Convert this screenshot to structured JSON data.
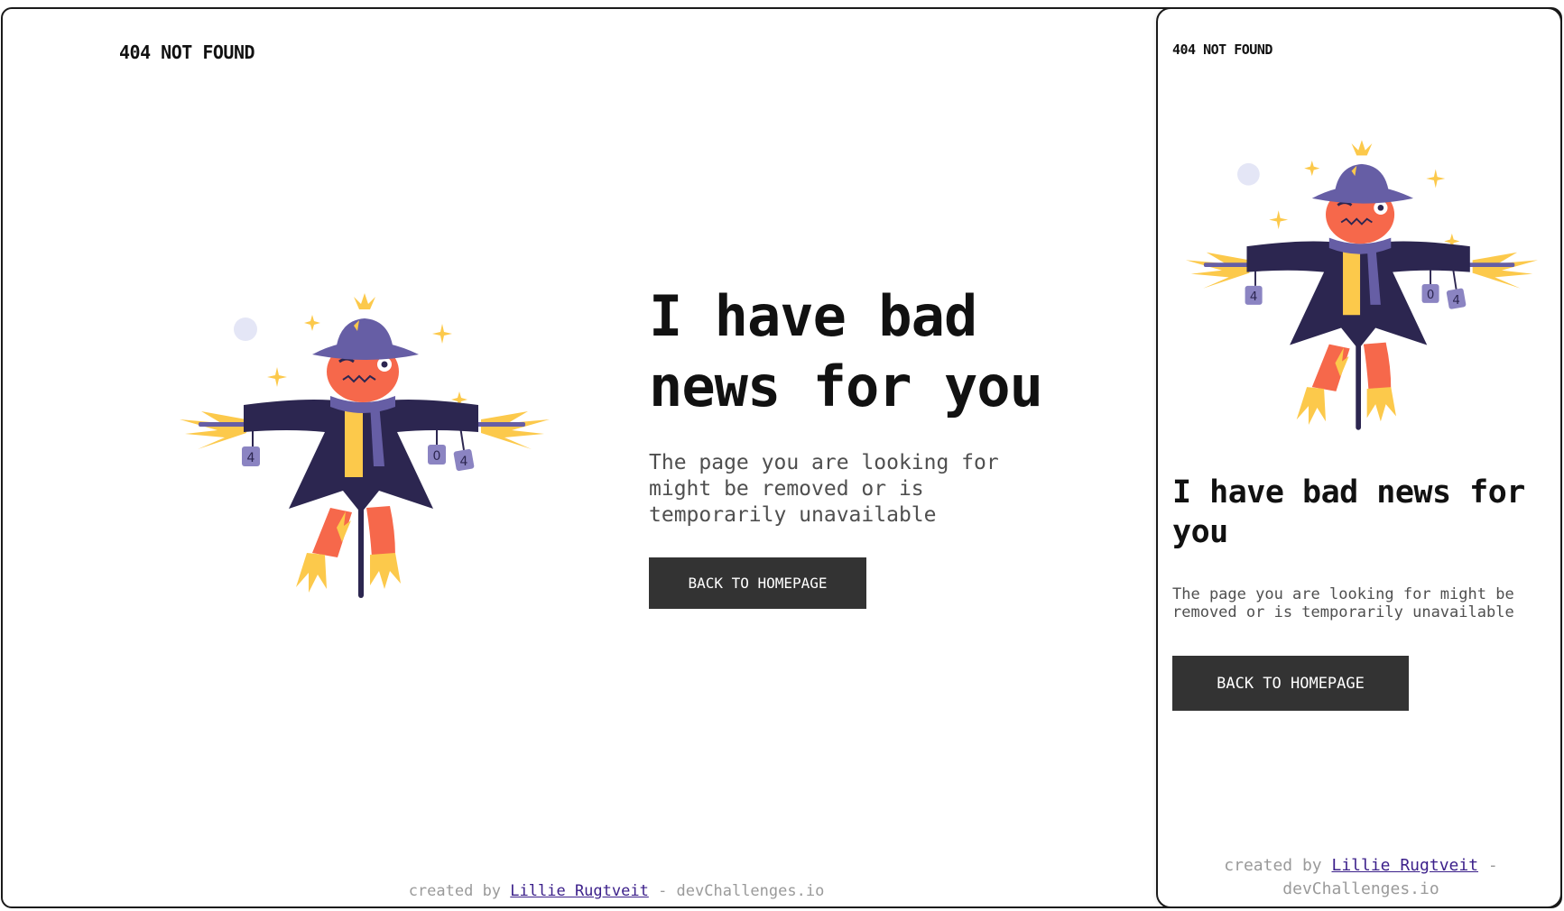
{
  "desktop": {
    "logo": "404 NOT FOUND",
    "headline": "I have bad news for you",
    "description": "The page you are looking for might be removed or is temporarily unavailable",
    "button_label": "BACK TO HOMEPAGE",
    "footer": {
      "prefix": "created by",
      "author": "Lillie Rugtveit",
      "suffix": "- devChallenges.io"
    }
  },
  "mobile": {
    "logo": "404 NOT FOUND",
    "headline": "I have bad news for you",
    "description": "The page you are looking for might be removed or is temporarily unavailable",
    "button_label": "BACK TO HOMEPAGE",
    "footer": {
      "prefix": "created by",
      "author": "Lillie Rugtveit",
      "suffix": "- devChallenges.io"
    }
  },
  "illustration": {
    "icon": "scarecrow-icon",
    "can_labels": [
      "4",
      "0",
      "4"
    ]
  },
  "colors": {
    "button_bg": "#333333",
    "button_text": "#ffffff",
    "heading": "#111111",
    "body_text": "#4f4f4f",
    "footer_text": "#9a9a9a",
    "link": "#3b1f8a",
    "coat": "#2c2650",
    "hat": "#665ea5",
    "face": "#f6684b",
    "straw": "#fcc94b"
  }
}
